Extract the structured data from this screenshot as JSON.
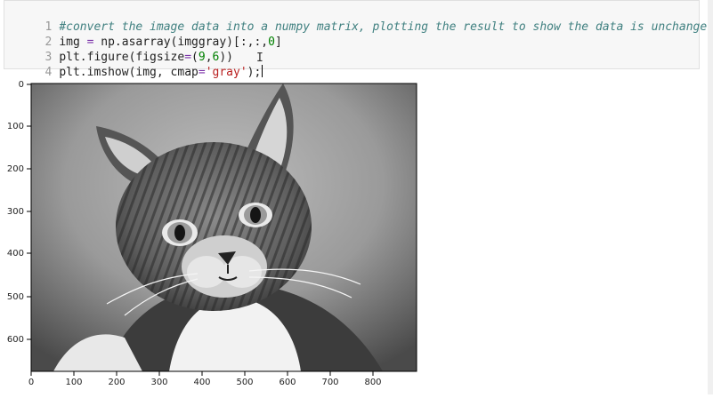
{
  "code_cell": {
    "lines": [
      {
        "num": "1",
        "comment": "#convert the image data into a numpy matrix, plotting the result to show the data is unchanged."
      },
      {
        "num": "2",
        "t1": "img ",
        "eq": "=",
        "t2": " np.asarray(imggray)[:,:,",
        "n0": "0",
        "t3": "]"
      },
      {
        "num": "3",
        "t1": "plt.figure(figsize",
        "eq": "=",
        "t2": "(",
        "n1": "9",
        "t3": ",",
        "n2": "6",
        "t4": "))"
      },
      {
        "num": "4",
        "t1": "plt.imshow(img, cmap",
        "eq": "=",
        "s": "'gray'",
        "t2": ");"
      }
    ]
  },
  "output": {
    "y_ticks": [
      "0",
      "100",
      "200",
      "300",
      "400",
      "500",
      "600"
    ],
    "x_ticks": [
      "0",
      "100",
      "200",
      "300",
      "400",
      "500",
      "600",
      "700",
      "800"
    ],
    "image_description_colormap": "gray"
  }
}
